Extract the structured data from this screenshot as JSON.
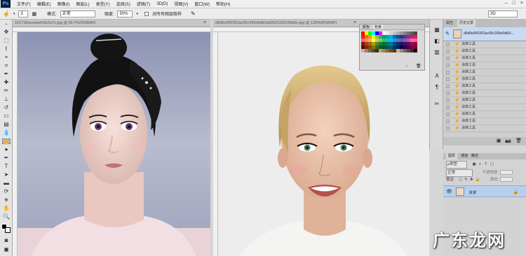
{
  "app": {
    "logo": "Ps",
    "window_controls": [
      "–",
      "□",
      "×"
    ]
  },
  "menu": [
    "文件(F)",
    "编辑(E)",
    "图像(I)",
    "图层(L)",
    "类型(Y)",
    "选择(S)",
    "滤镜(T)",
    "3D(D)",
    "视图(V)",
    "窗口(W)",
    "帮助(H)"
  ],
  "options": {
    "size_value": "3",
    "mode_label": "模式:",
    "mode_value": "正常",
    "strength_label": "强度:",
    "strength_value": "50%",
    "sample_all_label": "对所有图层取样",
    "workspace": "3D"
  },
  "documents": [
    {
      "title": "151718ouxsduhr8s2q7o.jpg @ 66.7%(RGB/8#)",
      "close": "×"
    },
    {
      "title": "d6d6e950352ac65c266e6db1faf2b21192138a5e.jpg @ 133%(RGB/8#)",
      "close": "×"
    }
  ],
  "swatches": {
    "tabs": [
      "颜色",
      "色板"
    ],
    "colors": [
      "#ff0000",
      "#ffff00",
      "#00ff00",
      "#00ffff",
      "#0000ff",
      "#ff00ff",
      "#ffffff",
      "#ebebeb",
      "#d6d6d6",
      "#c2c2c2",
      "#adadad",
      "#999999",
      "#858585",
      "#707070",
      "#5c5c5c",
      "#474747",
      "#ed1c24",
      "#f26522",
      "#f7941d",
      "#fff200",
      "#8dc63f",
      "#39b54a",
      "#00a651",
      "#00a99d",
      "#00aeef",
      "#0072bc",
      "#0054a6",
      "#2e3192",
      "#662d91",
      "#92278f",
      "#ec008c",
      "#ed145b",
      "#f26c4f",
      "#f68e56",
      "#fbaf5d",
      "#fff568",
      "#acd373",
      "#7cc576",
      "#3bb878",
      "#1abbb4",
      "#00bff3",
      "#438ccb",
      "#5574b9",
      "#605ca8",
      "#855fa8",
      "#a763a8",
      "#f06eaa",
      "#f26d7d",
      "#9e0b0f",
      "#a0410d",
      "#a36209",
      "#aba000",
      "#598527",
      "#1a7b30",
      "#007236",
      "#00746b",
      "#0076a3",
      "#004b80",
      "#003471",
      "#1b1464",
      "#440e62",
      "#630460",
      "#9e005d",
      "#9e0039",
      "#790000",
      "#7b2e00",
      "#7d4900",
      "#827b00",
      "#406618",
      "#005e20",
      "#005826",
      "#005952",
      "#005b7f",
      "#003663",
      "#002157",
      "#0d004c",
      "#32004b",
      "#4b0049",
      "#7b0046",
      "#7a0026",
      "#c7b299",
      "#998675",
      "#736357",
      "#534741",
      "#37302a",
      "#c69c6d",
      "#a67c52",
      "#8c6239",
      "#754c24",
      "#603913",
      "#c7b299",
      "#998675",
      "#736357",
      "#534741",
      "#37302a",
      "#000000"
    ]
  },
  "history": {
    "tabs": [
      "属性",
      "历史记录"
    ],
    "snapshot": "d6d6e950352ac65c266e6db1f...",
    "items": [
      "涂抹工具",
      "涂抹工具",
      "涂抹工具",
      "涂抹工具",
      "涂抹工具",
      "涂抹工具",
      "涂抹工具",
      "涂抹工具",
      "涂抹工具",
      "涂抹工具",
      "涂抹工具",
      "涂抹工具",
      "涂抹工具"
    ],
    "footer_icons": [
      "snapshot-icon",
      "camera-icon",
      "trash-icon"
    ]
  },
  "layers": {
    "tabs": [
      "图层",
      "通道",
      "路径"
    ],
    "kind_label": "ρ类型",
    "blend_mode": "正常",
    "opacity_label": "不透明度:",
    "lock_label": "锁定:",
    "fill_label": "填充:",
    "layer_name": "背景"
  },
  "watermark": "广东龙网"
}
